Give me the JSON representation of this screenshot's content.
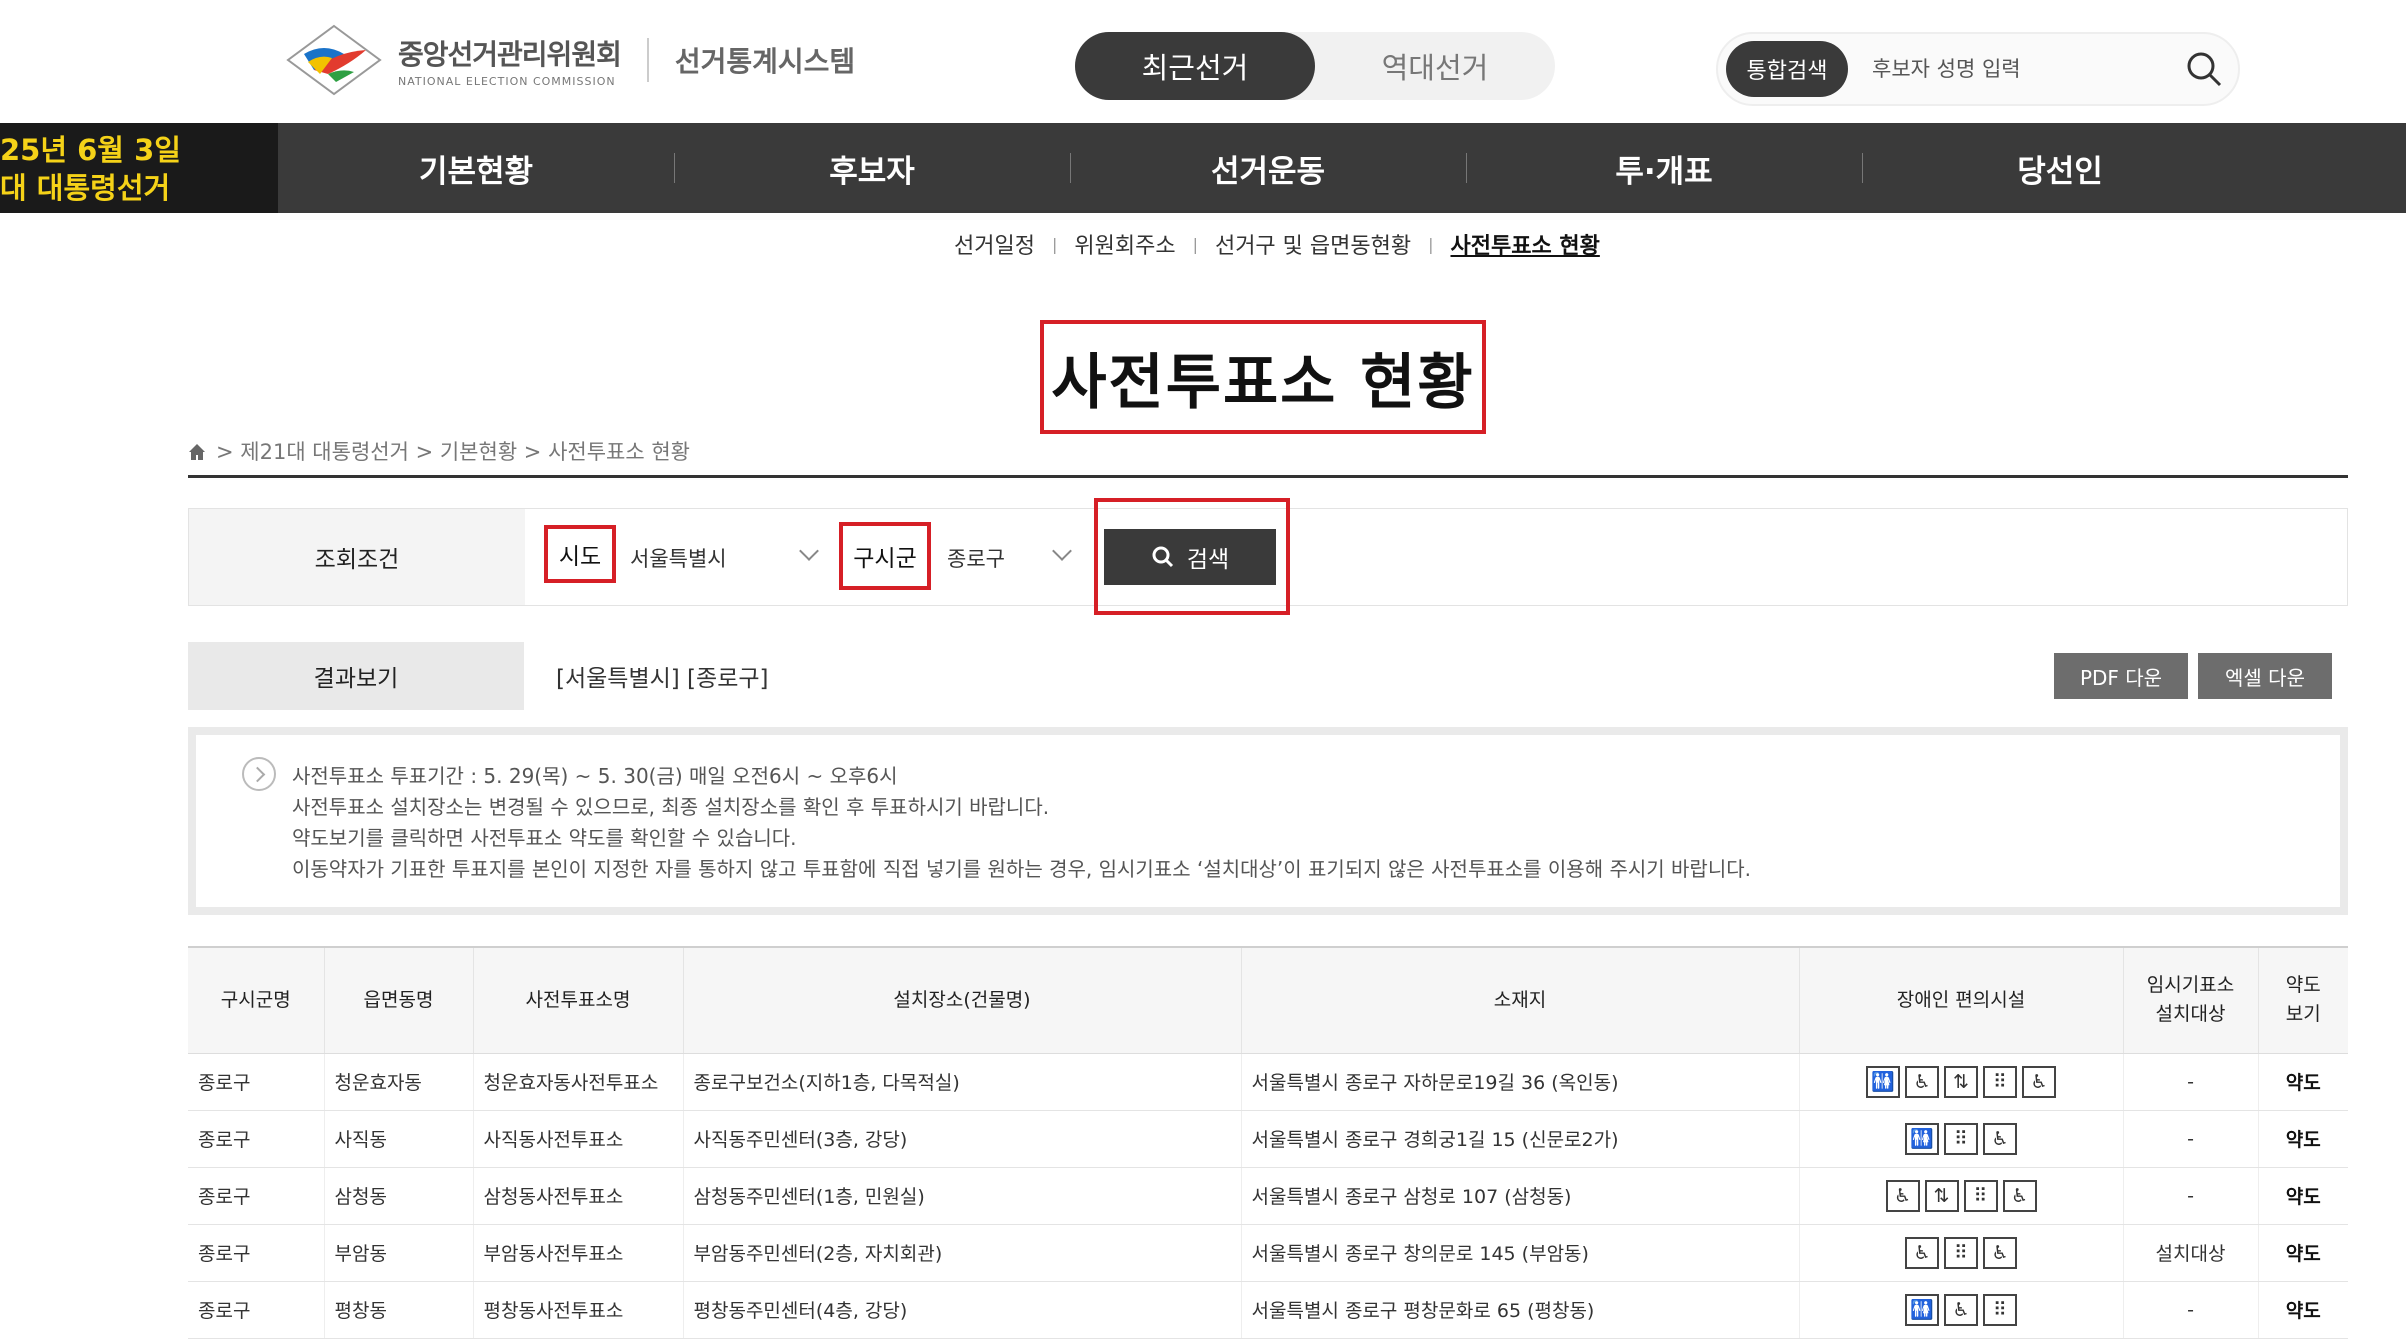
{
  "header": {
    "org_ko": "중앙선거관리위원회",
    "org_en": "NATIONAL ELECTION COMMISSION",
    "system": "선거통계시스템",
    "tabs": [
      "최근선거",
      "역대선거"
    ],
    "search_pill": "통합검색",
    "search_placeholder": "후보자 성명 입력"
  },
  "badge": {
    "line1": "25년 6월 3일",
    "line2": "대 대통령선거"
  },
  "menu": [
    "기본현황",
    "후보자",
    "선거운동",
    "투·개표",
    "당선인"
  ],
  "subnav": [
    "선거일정",
    "위원회주소",
    "선거구 및 읍면동현황",
    "사전투표소 현황"
  ],
  "page_title": "사전투표소 현황",
  "breadcrumb": "> 제21대 대통령선거 > 기본현황 > 사전투표소 현황",
  "filter": {
    "label": "조회조건",
    "sido_label": "시도",
    "sido_value": "서울특별시",
    "sigungu_label": "구시군",
    "sigungu_value": "종로구",
    "search_button": "검색"
  },
  "result": {
    "label": "결과보기",
    "value": "[서울특별시] [종로구]",
    "pdf_button": "PDF 다운",
    "excel_button": "엑셀 다운"
  },
  "notice": [
    "사전투표소 투표기간 : 5. 29(목) ~ 5. 30(금) 매일 오전6시 ~ 오후6시",
    "사전투표소 설치장소는 변경될 수 있으므로, 최종 설치장소를 확인 후 투표하시기 바랍니다.",
    "약도보기를 클릭하면 사전투표소 약도를 확인할 수 있습니다.",
    "이동약자가 기표한 투표지를 본인이 지정한 자를 통하지 않고 투표함에 직접 넣기를 원하는 경우, 임시기표소 ‘설치대상’이 표기되지 않은 사전투표소를 이용해 주시기 바랍니다."
  ],
  "table": {
    "headers": [
      "구시군명",
      "읍면동명",
      "사전투표소명",
      "설치장소(건물명)",
      "소재지",
      "장애인 편의시설",
      "임시기표소\n설치대상",
      "약도\n보기"
    ],
    "rows": [
      {
        "gu": "종로구",
        "dong": "청운효자동",
        "name": "청운효자동사전투표소",
        "place": "종로구보건소(지하1층, 다목적실)",
        "addr": "서울특별시 종로구 자하문로19길 36 (옥인동)",
        "fac": [
          "toilet-icon",
          "wheelchair-icon",
          "elevator-icon",
          "braille-icon",
          "wheelchair-icon"
        ],
        "temp": "-",
        "map": "약도"
      },
      {
        "gu": "종로구",
        "dong": "사직동",
        "name": "사직동사전투표소",
        "place": "사직동주민센터(3층, 강당)",
        "addr": "서울특별시 종로구 경희궁1길 15 (신문로2가)",
        "fac": [
          "toilet-icon",
          "braille-icon",
          "wheelchair-icon"
        ],
        "temp": "-",
        "map": "약도"
      },
      {
        "gu": "종로구",
        "dong": "삼청동",
        "name": "삼청동사전투표소",
        "place": "삼청동주민센터(1층, 민원실)",
        "addr": "서울특별시 종로구 삼청로 107 (삼청동)",
        "fac": [
          "wheelchair-icon",
          "elevator-icon",
          "braille-icon",
          "wheelchair-icon"
        ],
        "temp": "-",
        "map": "약도"
      },
      {
        "gu": "종로구",
        "dong": "부암동",
        "name": "부암동사전투표소",
        "place": "부암동주민센터(2층, 자치회관)",
        "addr": "서울특별시 종로구 창의문로 145 (부암동)",
        "fac": [
          "wheelchair-icon",
          "braille-icon",
          "wheelchair-icon"
        ],
        "temp": "설치대상",
        "map": "약도"
      },
      {
        "gu": "종로구",
        "dong": "평창동",
        "name": "평창동사전투표소",
        "place": "평창동주민센터(4층, 강당)",
        "addr": "서울특별시 종로구 평창문화로 65 (평창동)",
        "fac": [
          "toilet-icon",
          "wheelchair-icon",
          "braille-icon"
        ],
        "temp": "-",
        "map": "약도"
      }
    ]
  },
  "colors": {
    "highlight": "#d61f26",
    "dark": "#3a3a3a",
    "badge_text": "#f5d218"
  }
}
